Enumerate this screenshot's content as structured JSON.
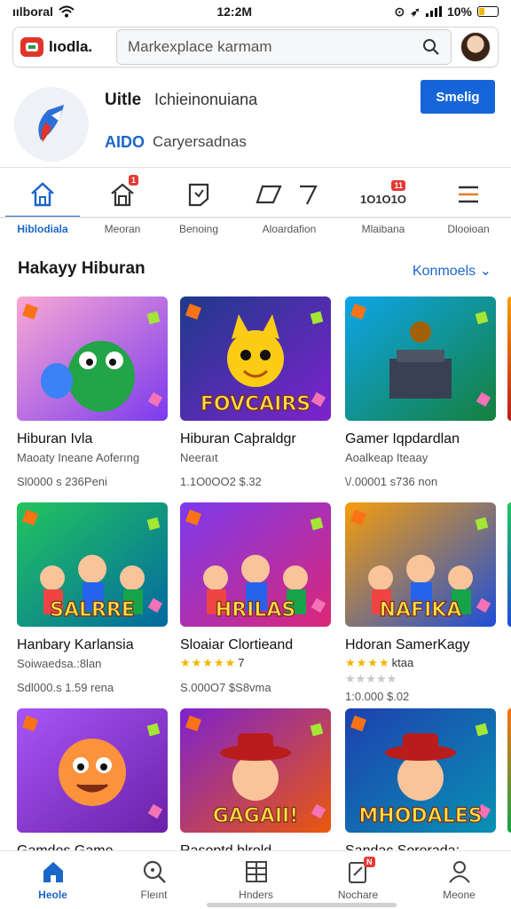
{
  "status_bar": {
    "carrier": "ıılboral",
    "time": "12:2M",
    "battery_percent": "10%",
    "battery_level": 0.25
  },
  "header": {
    "logo_text": "lıodla.",
    "search_placeholder": "Markexplace karmam"
  },
  "app": {
    "title": "Uitle",
    "subtitle": "Ichieinonuiana",
    "meta_code": "AIDO",
    "meta_text": "Caryersadnas",
    "action_label": "Smelig"
  },
  "tabs": [
    {
      "label": "Hiblodiala",
      "icon": "home-icon",
      "active": true
    },
    {
      "label": "Meoran",
      "icon": "store-icon",
      "badge": "1"
    },
    {
      "label": "Benoing",
      "icon": "tag-icon"
    },
    {
      "label": "Aloardafion",
      "icon": "flag-icon"
    },
    {
      "label": "Mlaibana",
      "icon": "counter-icon",
      "icon_text": "1O1O1O",
      "badge": "11"
    },
    {
      "label": "Dlooioan",
      "icon": "menu-icon"
    }
  ],
  "section": {
    "title": "Hakayy Hiburan",
    "link_label": "Konmoels"
  },
  "games": [
    {
      "title": "Hiburan Ivla",
      "subtitle": "Maoaty Ineane Aoferıng",
      "price": "Sl0000 s 236Peni",
      "art": "green-creature",
      "bg1": "#f9a8d4",
      "bg2": "#7c3aed"
    },
    {
      "title": "Hiburan Caþraldgr",
      "subtitle": "Neeraıt",
      "price": "1.1O0OO2 $.32",
      "art_text": "FOVCAIRS",
      "art": "cat",
      "bg1": "#1e3a8a",
      "bg2": "#7e22ce"
    },
    {
      "title": "Gamer Iqpdardlan",
      "subtitle": "Aoalkeap Iteaay",
      "price": "\\/.00001 s736 non",
      "art": "box",
      "bg1": "#0ea5e9",
      "bg2": "#15803d"
    },
    {
      "title": "Hanbary Karlansia",
      "subtitle": "Soiwaedsa.:8lan",
      "price": "Sdl000.s 1.59 rena",
      "art_text": "SALRRE",
      "art": "crowd",
      "bg1": "#22c55e",
      "bg2": "#0369a1"
    },
    {
      "title": "Sloaiar Clortieand",
      "stars": 5,
      "star_label": "7",
      "price": "S.000O7 $S8vma",
      "art_text": "HRILAS",
      "art": "crowd",
      "bg1": "#7c3aed",
      "bg2": "#db2777"
    },
    {
      "title": "Hdoran SamerKagy",
      "stars": 4,
      "star_label": "ktaa",
      "subtitle": "★★★★★",
      "price": "1:0.000 $.02",
      "art_text": "NAFIKA",
      "art": "crowd",
      "bg1": "#f59e0b",
      "bg2": "#1d4ed8"
    },
    {
      "title": "Gamdes Game",
      "art": "sun",
      "bg1": "#a855f7",
      "bg2": "#6b21a8"
    },
    {
      "title": "Rasoptd blrold",
      "art_text": "GAGAII!",
      "art": "cowboy",
      "bg1": "#7e22ce",
      "bg2": "#ea580c"
    },
    {
      "title": "Sandac Sorerada:",
      "art_text": "MHODALES",
      "art": "cowboy",
      "bg1": "#1e40af",
      "bg2": "#0891b2"
    }
  ],
  "bottom_nav": [
    {
      "label": "Heole",
      "icon": "home-icon",
      "active": true
    },
    {
      "label": "Fleınt",
      "icon": "search-icon"
    },
    {
      "label": "Hnders",
      "icon": "grid-icon"
    },
    {
      "label": "Nochare",
      "icon": "notes-icon",
      "badge": "N"
    },
    {
      "label": "Meone",
      "icon": "profile-icon"
    }
  ],
  "colors": {
    "accent": "#1b66c9",
    "button": "#1565d8",
    "badge": "#e53935",
    "star": "#f4b400"
  }
}
